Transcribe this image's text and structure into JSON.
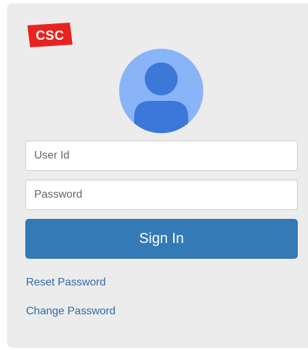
{
  "logo": {
    "text": "CSC",
    "color": "#e8231f",
    "icon": "csc-logo"
  },
  "avatar": {
    "icon": "user-avatar-icon",
    "background": "#8ab4f8",
    "figure_color": "#3c78d8"
  },
  "form": {
    "userid_placeholder": "User Id",
    "userid_value": "",
    "password_placeholder": "Password",
    "password_value": ""
  },
  "buttons": {
    "signin_label": "Sign In",
    "signin_color": "#337ab7"
  },
  "links": {
    "reset_password": "Reset Password",
    "change_password": "Change Password",
    "color": "#2f6aa8"
  }
}
